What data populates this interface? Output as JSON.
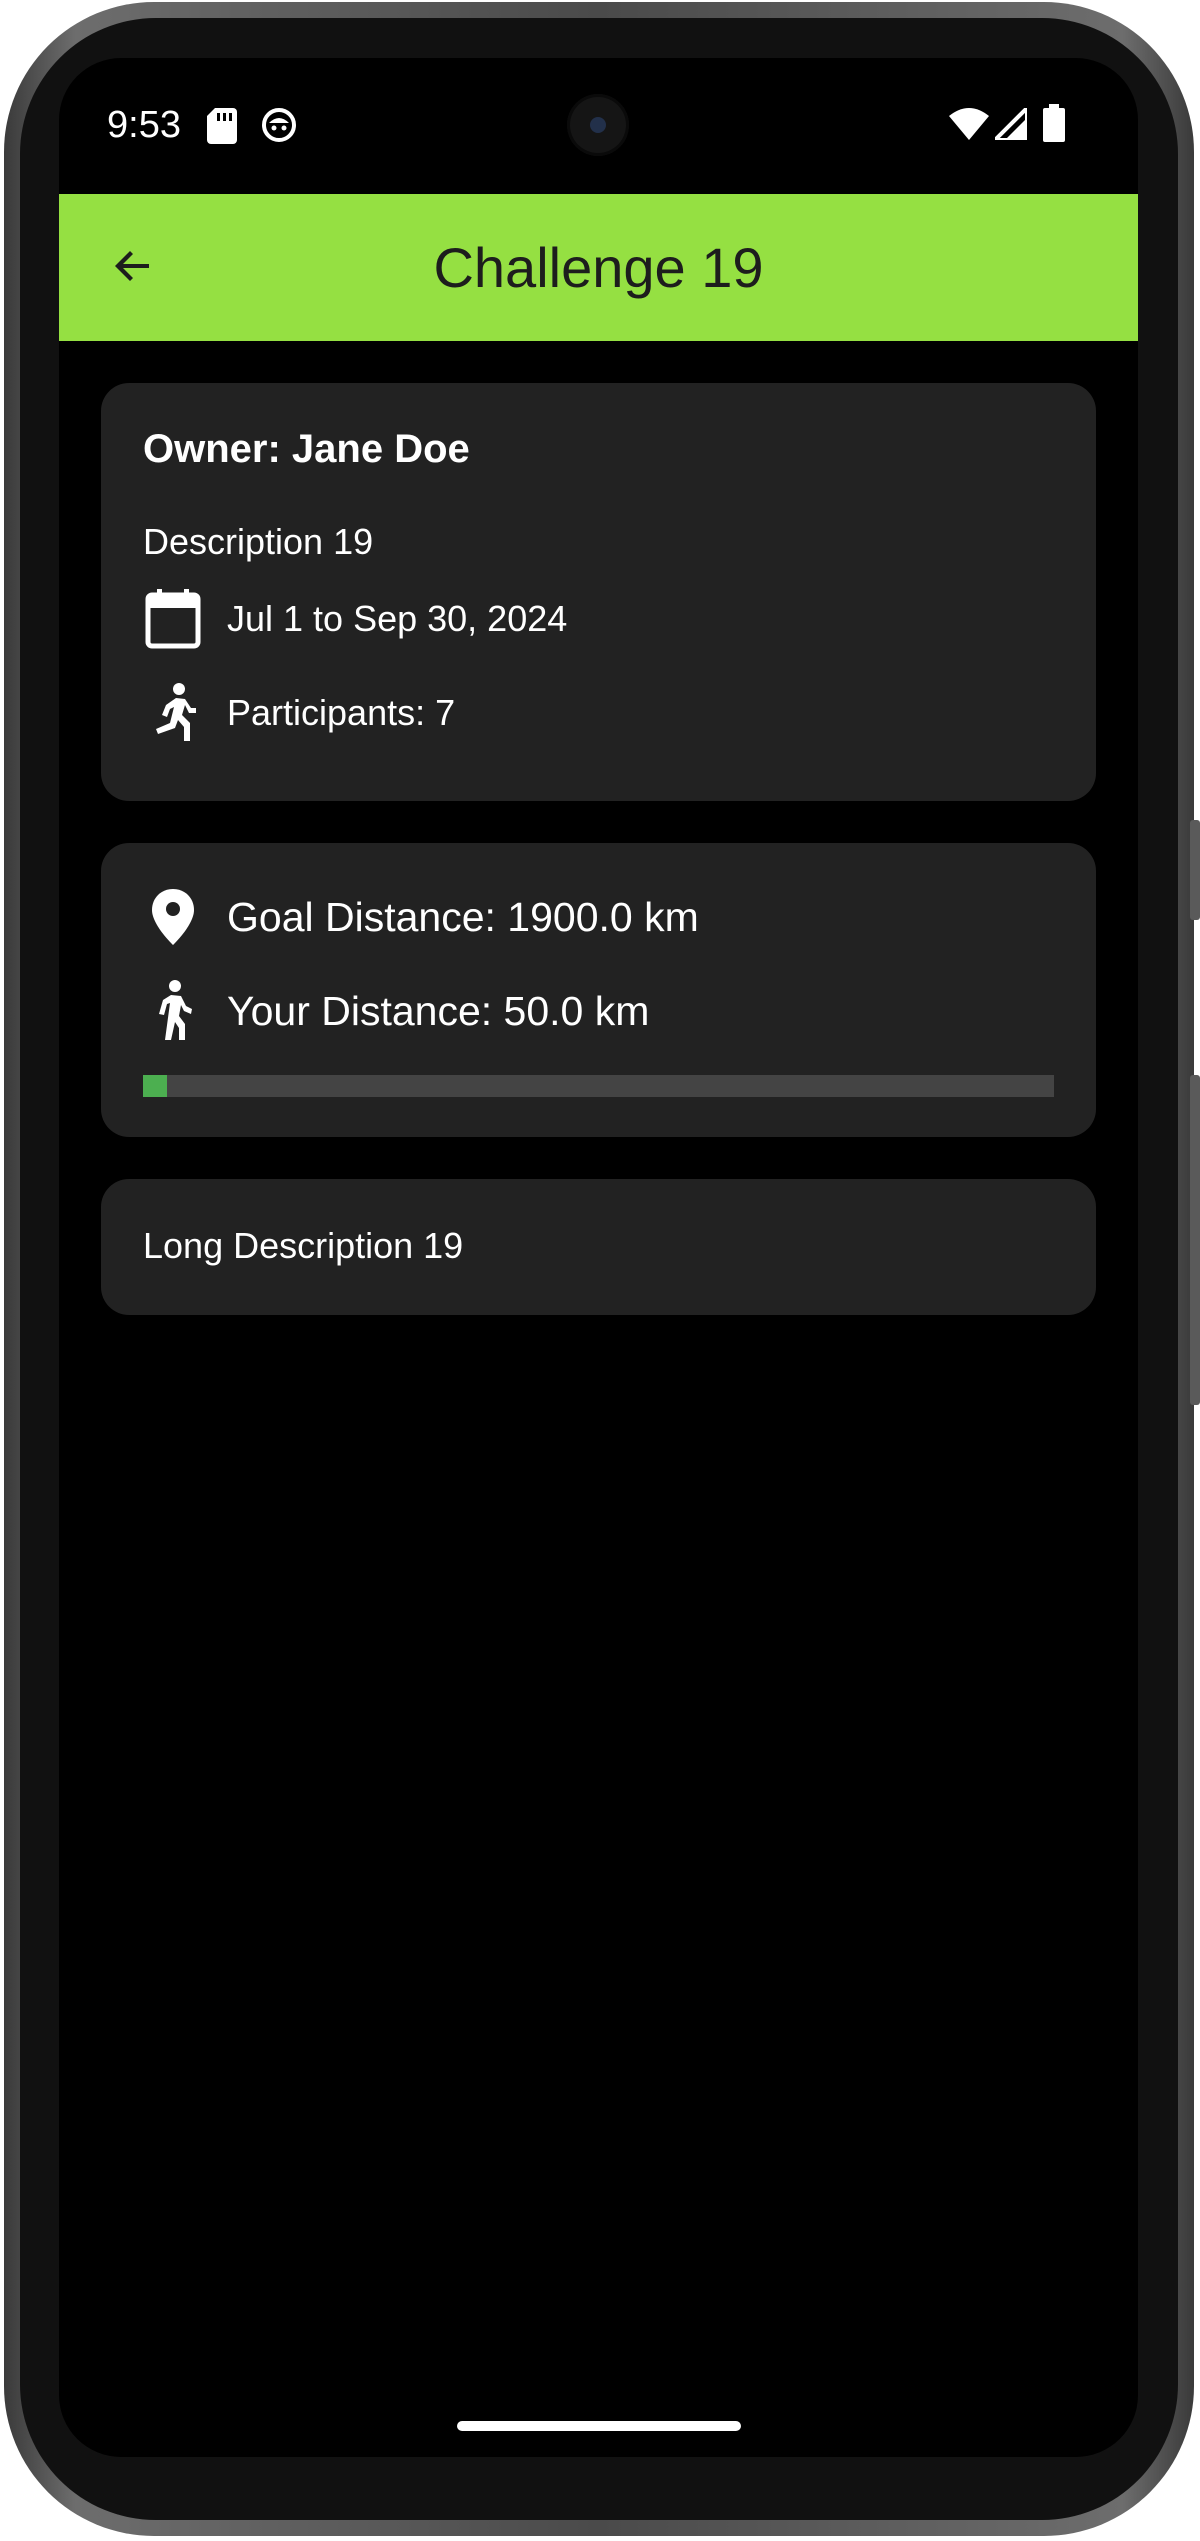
{
  "status_bar": {
    "time": "9:53",
    "left_icons": [
      "sd-card-icon",
      "cat-face-icon"
    ],
    "right_icons": [
      "wifi-icon",
      "signal-icon",
      "battery-icon"
    ]
  },
  "app_bar": {
    "title": "Challenge 19",
    "back_icon": "arrow-back-icon",
    "background": "#95e042"
  },
  "info_card": {
    "owner": "Owner: Jane Doe",
    "description": "Description 19",
    "date_range": "Jul 1 to Sep 30, 2024",
    "participants": "Participants: 7"
  },
  "distance_card": {
    "goal": "Goal Distance: 1900.0 km",
    "yours": "Your Distance: 50.0 km",
    "progress_fraction": 0.026,
    "progress_color": "#4caf50"
  },
  "long_description_card": {
    "text": "Long Description 19"
  }
}
